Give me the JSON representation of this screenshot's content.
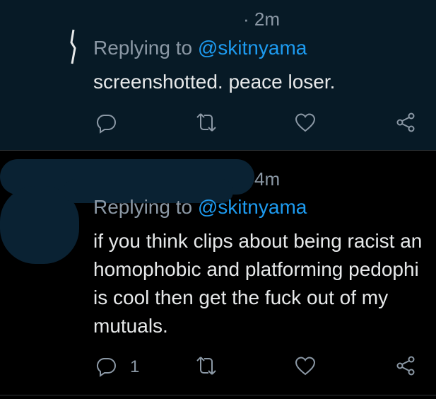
{
  "tweets": [
    {
      "time": "· 2m",
      "reply_prefix": "Replying to ",
      "reply_handle": "@skitnyama",
      "text": "screenshotted. peace loser.",
      "reply_count": ""
    },
    {
      "time": "4m",
      "reply_prefix": "Replying to ",
      "reply_handle": "@skitnyama",
      "text_lines": [
        "if you think clips about being racist an",
        "homophobic and platforming pedophi",
        "is cool then get the fuck out of my",
        "mutuals."
      ],
      "reply_count": "1"
    }
  ],
  "icons": [
    "reply-icon",
    "retweet-icon",
    "like-icon",
    "share-icon"
  ],
  "colors": {
    "background_top": "#071a26",
    "background_bottom": "#000000",
    "accent": "#1d9bf0",
    "muted": "#8b98a5",
    "text": "#e7e9ea"
  }
}
